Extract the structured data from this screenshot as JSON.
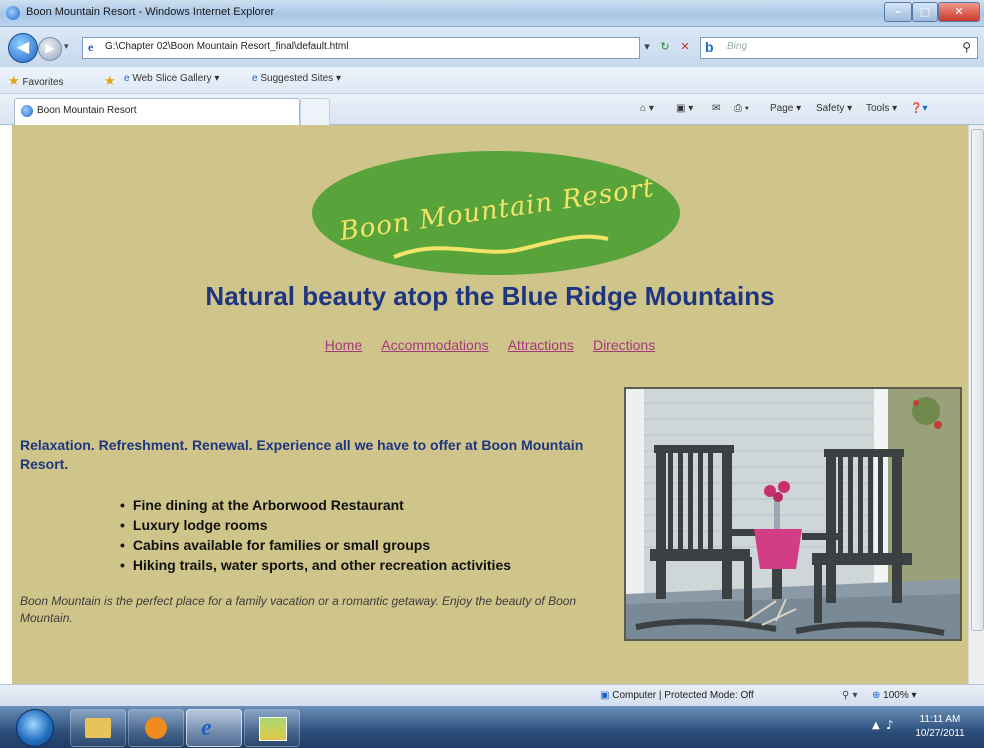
{
  "window": {
    "title": "Boon Mountain Resort - Windows Internet Explorer",
    "minimize": "–",
    "maximize": "□",
    "close": "✕"
  },
  "address_bar": {
    "url": "G:\\Chapter 02\\Boon Mountain Resort_final\\default.html",
    "search_placeholder": "Bing"
  },
  "favorites_bar": {
    "favorites_label": "Favorites",
    "items": [
      "Web Slice Gallery ▾",
      "Suggested Sites ▾"
    ]
  },
  "tabs": [
    {
      "label": "Boon Mountain Resort"
    }
  ],
  "command_bar": {
    "page": "Page ▾",
    "safety": "Safety ▾",
    "tools": "Tools ▾",
    "help": "❓▾"
  },
  "page": {
    "logo_text": "Boon Mountain Resort",
    "headline": "Natural beauty atop the Blue Ridge Mountains",
    "nav": [
      "Home",
      "Accommodations",
      "Attractions",
      "Directions"
    ],
    "intro": "Relaxation. Refreshment. Renewal. Experience all we have to offer at Boon Mountain Resort.",
    "bullets": [
      "Fine dining at the Arborwood Restaurant",
      "Luxury lodge rooms",
      "Cabins available for families or small groups",
      "Hiking trails, water sports, and other recreation activities"
    ],
    "closing": " Boon Mountain is the perfect place for a family vacation or a romantic getaway. Enjoy the beauty of Boon Mountain.",
    "colors": {
      "background": "#cfc58a",
      "headline": "#1f3580",
      "nav_link": "#a23a7c",
      "logo_fill": "#58a33a",
      "logo_text": "#f3e56a"
    }
  },
  "status_bar": {
    "text": "Computer | Protected Mode: Off",
    "zoom": "100%"
  },
  "taskbar": {
    "time": "11:11 AM",
    "date": "10/27/2011"
  }
}
